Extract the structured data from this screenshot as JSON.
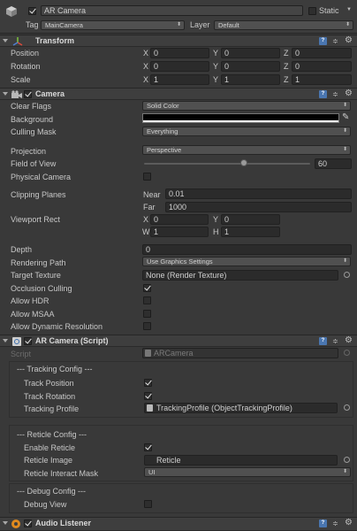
{
  "object": {
    "name": "AR Camera",
    "static_label": "Static",
    "tag_label": "Tag",
    "tag_value": "MainCamera",
    "layer_label": "Layer",
    "layer_value": "Default"
  },
  "transform": {
    "title": "Transform",
    "rows": [
      {
        "label": "Position",
        "x": "0",
        "y": "0",
        "z": "0"
      },
      {
        "label": "Rotation",
        "x": "0",
        "y": "0",
        "z": "0"
      },
      {
        "label": "Scale",
        "x": "1",
        "y": "1",
        "z": "1"
      }
    ]
  },
  "axis": {
    "x": "X",
    "y": "Y",
    "z": "Z",
    "w": "W",
    "h": "H"
  },
  "camera": {
    "title": "Camera",
    "clear_flags": {
      "label": "Clear Flags",
      "value": "Solid Color"
    },
    "background": {
      "label": "Background",
      "color": "#000000"
    },
    "culling_mask": {
      "label": "Culling Mask",
      "value": "Everything"
    },
    "projection": {
      "label": "Projection",
      "value": "Perspective"
    },
    "fov": {
      "label": "Field of View",
      "value": "60",
      "fraction": 0.6
    },
    "physical_camera": {
      "label": "Physical Camera",
      "checked": false
    },
    "clipping": {
      "label": "Clipping Planes",
      "near_label": "Near",
      "near": "0.01",
      "far_label": "Far",
      "far": "1000"
    },
    "viewport": {
      "label": "Viewport Rect",
      "x": "0",
      "y": "0",
      "w": "1",
      "h": "1"
    },
    "depth": {
      "label": "Depth",
      "value": "0"
    },
    "rendering_path": {
      "label": "Rendering Path",
      "value": "Use Graphics Settings"
    },
    "target_texture": {
      "label": "Target Texture",
      "value": "None (Render Texture)"
    },
    "occlusion_culling": {
      "label": "Occlusion Culling",
      "checked": true
    },
    "allow_hdr": {
      "label": "Allow HDR",
      "checked": false
    },
    "allow_msaa": {
      "label": "Allow MSAA",
      "checked": false
    },
    "allow_dynamic_resolution": {
      "label": "Allow Dynamic Resolution",
      "checked": false
    }
  },
  "ar_script": {
    "title": "AR Camera (Script)",
    "script_label": "Script",
    "script_value": "ARCamera",
    "tracking_header": "--- Tracking Config ---",
    "track_position": {
      "label": "Track Position",
      "checked": true
    },
    "track_rotation": {
      "label": "Track Rotation",
      "checked": true
    },
    "tracking_profile": {
      "label": "Tracking Profile",
      "value": "TrackingProfile (ObjectTrackingProfile)"
    },
    "reticle_header": "--- Reticle Config ---",
    "enable_reticle": {
      "label": "Enable Reticle",
      "checked": true
    },
    "reticle_image": {
      "label": "Reticle Image",
      "value": "Reticle"
    },
    "reticle_mask": {
      "label": "Reticle Interact Mask",
      "value": "UI"
    },
    "debug_header": "--- Debug Config ---",
    "debug_view": {
      "label": "Debug View",
      "checked": false
    }
  },
  "audio_listener": {
    "title": "Audio Listener"
  },
  "icons": {
    "help": "help-book-icon",
    "preset": "preset-sliders-icon",
    "settings": "gear-icon",
    "object_picker": "object-picker-circle-icon"
  },
  "colors": {
    "panel_bg": "#393939",
    "header_bg": "#3e3e3e",
    "field_bg": "#2b2b2b",
    "help_blue": "#4a76b0",
    "audio_orange": "#e08a1e"
  }
}
